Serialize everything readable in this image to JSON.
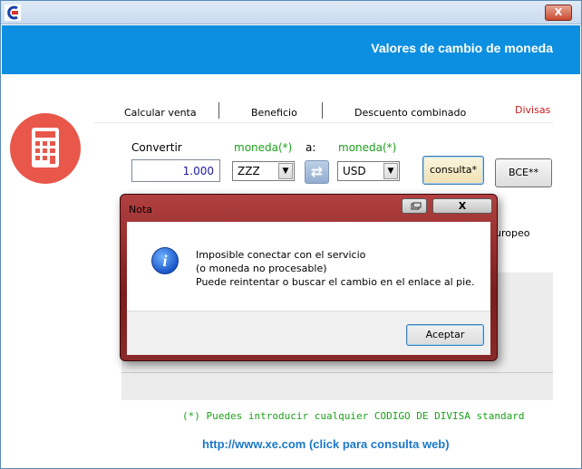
{
  "window": {
    "title": "",
    "close_label": "X"
  },
  "banner": {
    "title": "Valores de cambio de moneda"
  },
  "tabs": [
    {
      "label": "Calcular venta"
    },
    {
      "label": "Beneficio"
    },
    {
      "label": "Descuento combinado"
    },
    {
      "label": "Divisas"
    }
  ],
  "converter": {
    "convert_label": "Convertir",
    "from_label": "moneda(*)",
    "to_word": "a:",
    "to_label": "moneda(*)",
    "amount": "1.000",
    "from_currency": "ZZZ",
    "to_currency": "USD",
    "swap_icon": "⇄",
    "consulta_label": "consulta*",
    "bce_label": "BCE**"
  },
  "partial_text": "uropeo",
  "footer": {
    "note": "(*) Puedes introducir cualquier CODIGO DE DIVISA standard",
    "link": "http://www.xe.com (click para consulta web)"
  },
  "dialog": {
    "title": "Nota",
    "close_label": "X",
    "icon": "info-icon",
    "info_glyph": "i",
    "message_lines": [
      "Imposible conectar con el servicio",
      "(o moneda no procesable)",
      "Puede reintentar o buscar el cambio en el enlace al pie."
    ],
    "ok_label": "Aceptar"
  },
  "colors": {
    "banner": "#0c8fe0",
    "accent_green": "#1ca11c",
    "tab_active": "#cc1b1b",
    "link": "#1b78c9",
    "dialog_frame": "#7a1e1e"
  }
}
